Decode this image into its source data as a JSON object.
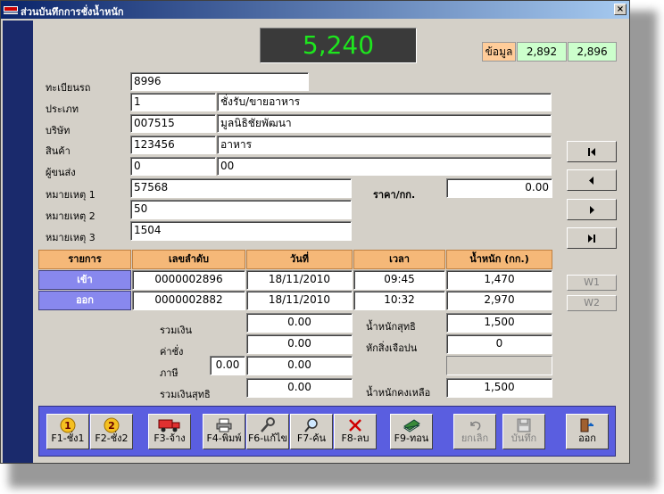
{
  "window": {
    "title": "ส่วนบันทึกการชั่งน้ำหนัก",
    "close_label": "×"
  },
  "display": {
    "weight": "5,240"
  },
  "info": {
    "label": "ข้อมูล",
    "value1": "2,892",
    "value2": "2,896"
  },
  "form": {
    "plate_label": "ทะเบียนรถ",
    "plate_value": "8996",
    "type_label": "ประเภท",
    "type_code": "1",
    "type_name": "ชั่งรับ/ขายอาหาร",
    "company_label": "บริษัท",
    "company_code": "007515",
    "company_name": "มูลนิธิชัยพัฒนา",
    "product_label": "สินค้า",
    "product_code": "123456",
    "product_name": "อาหาร",
    "sender_label": "ผู้ขนส่ง",
    "sender_code": "0",
    "sender_name": "00",
    "note1_label": "หมายเหตุ 1",
    "note1_value": "57568",
    "note2_label": "หมายเหตุ 2",
    "note2_value": "50",
    "note3_label": "หมายเหตุ 3",
    "note3_value": "1504",
    "price_label": "ราคา/กก.",
    "price_value": "0.00"
  },
  "table": {
    "headers": [
      "รายการ",
      "เลขลำดับ",
      "วันที่",
      "เวลา",
      "น้ำหนัก (กก.)"
    ],
    "rows": [
      {
        "label": "เข้า",
        "seq": "0000002896",
        "date": "18/11/2010",
        "time": "09:45",
        "weight": "1,470"
      },
      {
        "label": "ออก",
        "seq": "0000002882",
        "date": "18/11/2010",
        "time": "10:32",
        "weight": "2,970"
      }
    ]
  },
  "summary": {
    "total_label": "รวมเงิน",
    "total_value": "0.00",
    "fee_label": "ค่าชั่ง",
    "fee_value": "0.00",
    "tax_label": "ภาษี",
    "tax_rate": "0.00",
    "tax_value": "0.00",
    "net_total_label": "รวมเงินสุทธิ",
    "net_total_value": "0.00",
    "net_weight_label": "น้ำหนักสุทธิ",
    "net_weight_value": "1,500",
    "deduct_label": "หักสิ่งเจือปน",
    "deduct_value": "0",
    "remain_label": "น้ำหนักคงเหลือ",
    "remain_value": "1,500"
  },
  "side": {
    "w1_label": "W1",
    "w2_label": "W2"
  },
  "toolbar": {
    "f1_label": "F1-ชั่ง1",
    "f1_icon_text": "1",
    "f2_label": "F2-ชั่ง2",
    "f2_icon_text": "2",
    "f3_label": "F3-จ้าง",
    "f4_label": "F4-พิมพ์",
    "f6_label": "F6-แก้ไข",
    "f7_label": "F7-ค้น",
    "f8_label": "F8-ลบ",
    "f9_label": "F9-ทอน",
    "cancel_label": "ยกเลิก",
    "save_label": "บันทึก",
    "exit_label": "ออก"
  },
  "colors": {
    "weight_text": "#1ee61e",
    "header_orange": "#f5b878",
    "row_purple": "#8888ee",
    "toolbar_blue": "#5a5ee0",
    "info_green": "#ccffcc",
    "info_orange": "#ffcc99"
  }
}
